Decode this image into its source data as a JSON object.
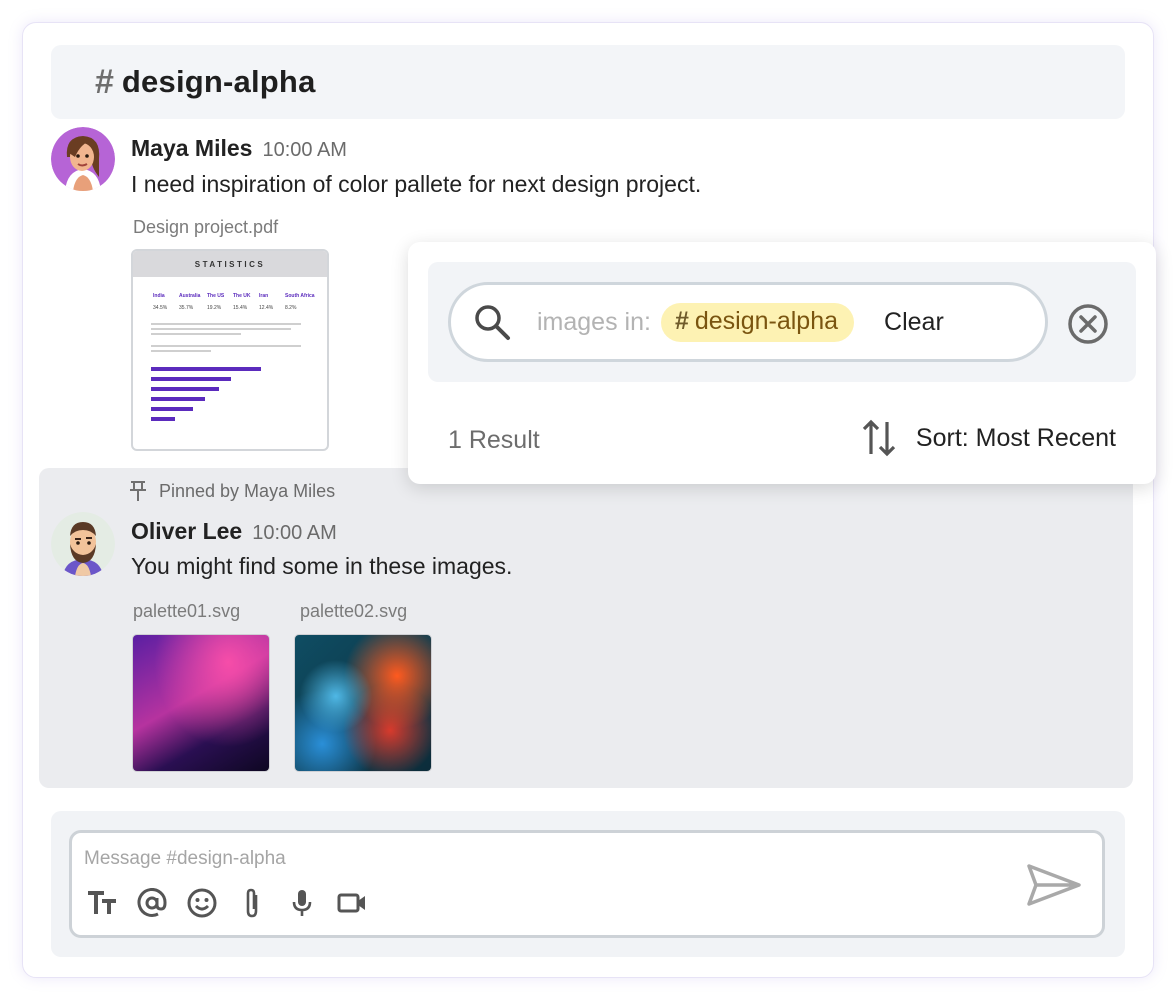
{
  "channel": {
    "hash": "#",
    "name": "design-alpha"
  },
  "messages": [
    {
      "author": "Maya Miles",
      "time": "10:00 AM",
      "text": "I need inspiration of color pallete for next design project.",
      "attachment": {
        "file_name": "Design project.pdf",
        "preview_title": "STATISTICS",
        "preview_columns": [
          "India",
          "Australia",
          "The US",
          "The UK",
          "Iran",
          "South Africa"
        ],
        "preview_values": [
          "34.5%",
          "35.7%",
          "19.2%",
          "15.4%",
          "12.4%",
          "8.2%"
        ]
      }
    },
    {
      "pinned_by": "Pinned by Maya Miles",
      "author": "Oliver Lee",
      "time": "10:00 AM",
      "text": "You might find some in these images.",
      "images": [
        {
          "file_name": "palette01.svg"
        },
        {
          "file_name": "palette02.svg"
        }
      ]
    }
  ],
  "search": {
    "prefix": "images in:",
    "tag_hash": "#",
    "tag": "design-alpha",
    "clear_label": "Clear",
    "result_count": "1 Result",
    "sort_label": "Sort: Most Recent"
  },
  "composer": {
    "placeholder": "Message #design-alpha",
    "tools": [
      "text-format-icon",
      "mention-icon",
      "emoji-icon",
      "attach-icon",
      "microphone-icon",
      "video-icon"
    ]
  },
  "colors": {
    "tag_bg": "#fdf2b3",
    "pinned_bg": "#ebecef",
    "bar_purple": "#5b2bbd"
  }
}
